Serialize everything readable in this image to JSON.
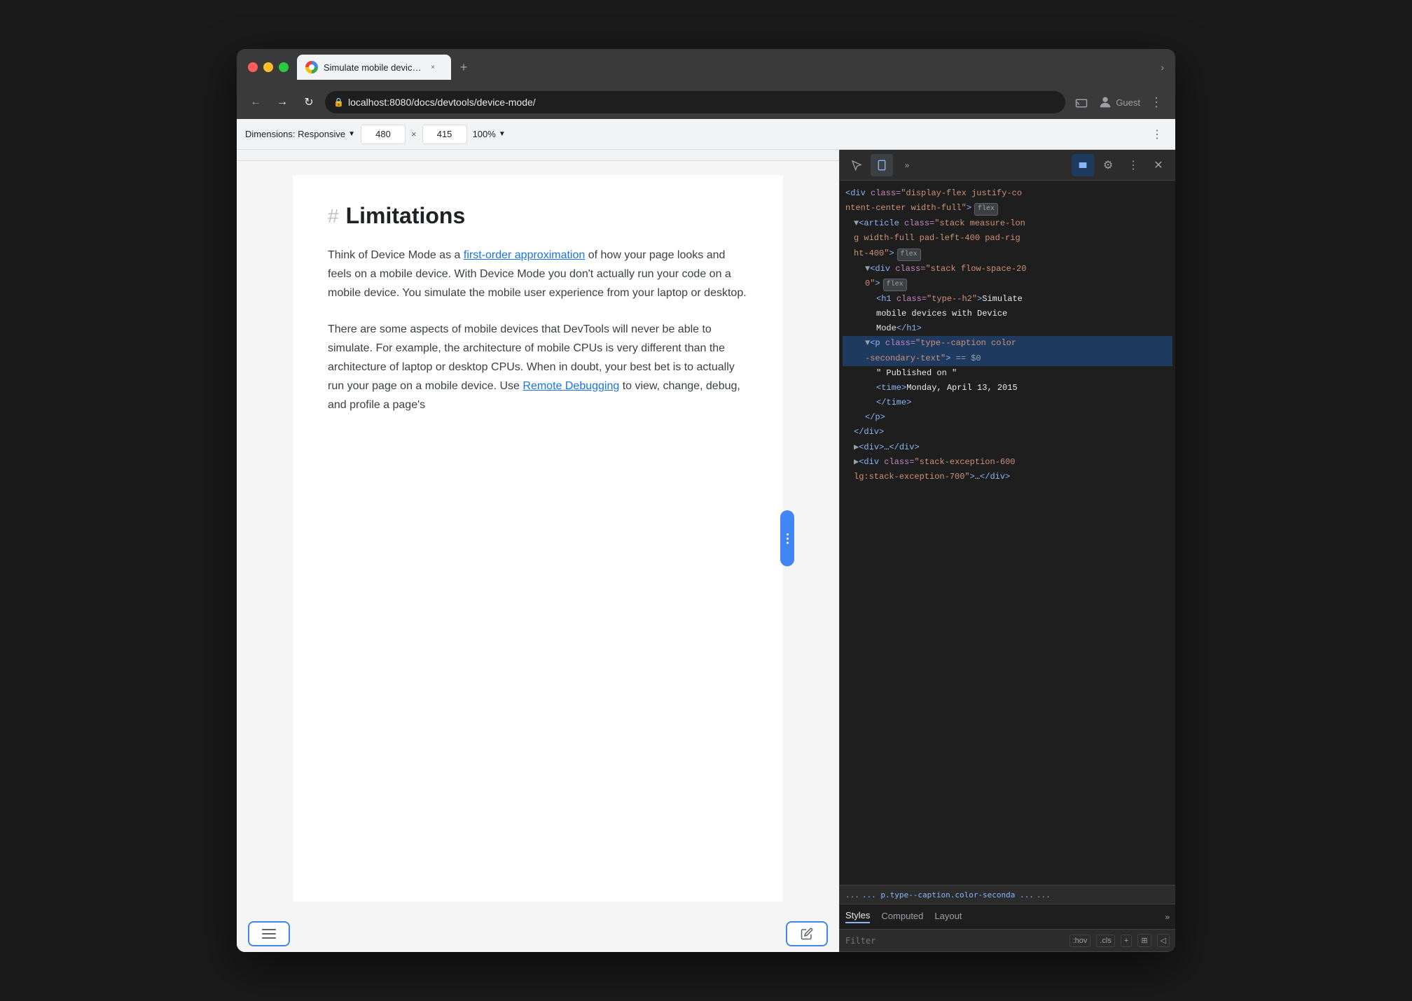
{
  "browser": {
    "title": "Simulate mobile devices with D",
    "url": "localhost:8080/docs/devtools/device-mode/",
    "tab_close": "×",
    "tab_new": "+",
    "tab_more": "›",
    "nav_back": "←",
    "nav_forward": "→",
    "nav_reload": "↻",
    "profile_label": "Guest"
  },
  "device_toolbar": {
    "dimensions_label": "Dimensions: Responsive",
    "width_value": "480",
    "height_value": "415",
    "zoom_label": "100%"
  },
  "page": {
    "heading": "Limitations",
    "hash": "#",
    "paragraph1": "Think of Device Mode as a first-order approximation of how your page looks and feels on a mobile device. With Device Mode you don't actually run your code on a mobile device. You simulate the mobile user experience from your laptop or desktop.",
    "paragraph1_link": "first-order approximation",
    "paragraph2": "There are some aspects of mobile devices that DevTools will never be able to simulate. For example, the architecture of mobile CPUs is very different than the architecture of laptop or desktop CPUs. When in doubt, your best bet is to actually run your page on a mobile device. Use Remote Debugging to view, change, debug, and profile a page's",
    "paragraph2_link1": "Remote",
    "paragraph2_link2": "Debugging"
  },
  "devtools": {
    "toolbar_buttons": [
      "cursor",
      "device",
      "more",
      "console",
      "settings",
      "more-vert",
      "close"
    ],
    "html_lines": [
      {
        "indent": 0,
        "content": "<div class=\"display-flex justify-co",
        "badge": "",
        "selected": false
      },
      {
        "indent": 0,
        "content": "ntent-center width-full\">",
        "badge": "flex",
        "selected": false
      },
      {
        "indent": 1,
        "content": "<article class=\"stack measure-lon",
        "badge": "",
        "selected": false
      },
      {
        "indent": 1,
        "content": "g width-full pad-left-400 pad-rig",
        "badge": "",
        "selected": false
      },
      {
        "indent": 1,
        "content": "ht-400\">",
        "badge": "flex",
        "selected": false
      },
      {
        "indent": 2,
        "content": "<div class=\"stack flow-space-20",
        "badge": "",
        "selected": false
      },
      {
        "indent": 2,
        "content": "0\">",
        "badge": "flex",
        "selected": false
      },
      {
        "indent": 3,
        "content": "h1 class=\"type--h2\">Simulate",
        "badge": "",
        "selected": false
      },
      {
        "indent": 3,
        "content": "mobile devices with Device",
        "badge": "",
        "selected": false
      },
      {
        "indent": 3,
        "content": "Mode</h1>",
        "badge": "",
        "selected": false
      },
      {
        "indent": 2,
        "content": "<p class=\"type--caption color",
        "badge": "",
        "selected": true
      },
      {
        "indent": 2,
        "content": "-secondary-text\">",
        "badge": "==$0",
        "selected": true
      },
      {
        "indent": 3,
        "content": "\" Published on \"",
        "badge": "",
        "selected": false
      },
      {
        "indent": 3,
        "content": "<time>Monday, April 13, 2015",
        "badge": "",
        "selected": false
      },
      {
        "indent": 3,
        "content": "</time>",
        "badge": "",
        "selected": false
      },
      {
        "indent": 2,
        "content": "</p>",
        "badge": "",
        "selected": false
      },
      {
        "indent": 1,
        "content": "</div>",
        "badge": "",
        "selected": false
      },
      {
        "indent": 1,
        "content": "<div>…</div>",
        "badge": "",
        "selected": false
      },
      {
        "indent": 1,
        "content": "<div class=\"stack-exception-600",
        "badge": "",
        "selected": false
      },
      {
        "indent": 1,
        "content": "lg:stack-exception-700\">…</div>",
        "badge": "",
        "selected": false
      }
    ],
    "breadcrumb": "... p.type--caption.color-seconda ...",
    "styles_tabs": [
      "Styles",
      "Computed",
      "Layout",
      ">>"
    ],
    "filter_placeholder": "Filter",
    "filter_buttons": [
      ":hov",
      ".cls",
      "+",
      "⊞",
      "◁"
    ]
  }
}
